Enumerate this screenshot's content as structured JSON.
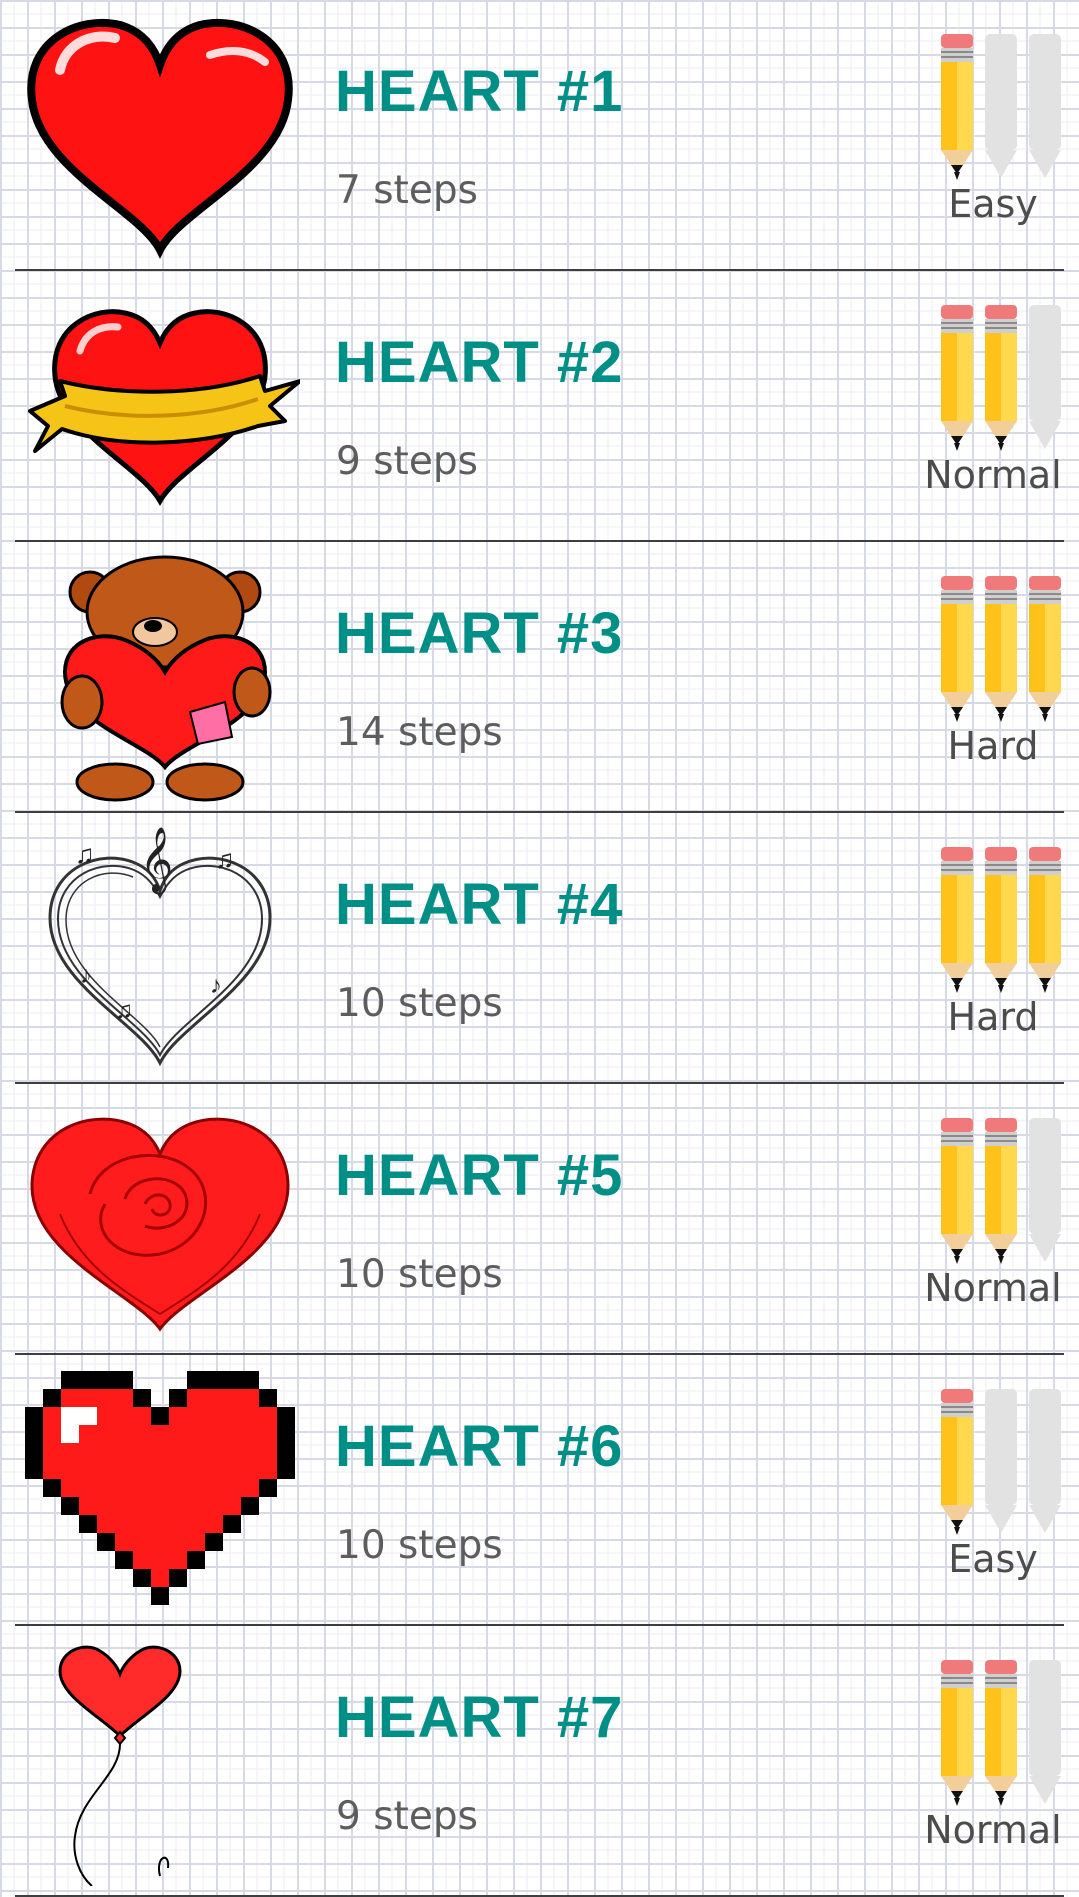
{
  "items": [
    {
      "title": "HEART #1",
      "steps": "7 steps",
      "difficulty": "Easy",
      "level": 1,
      "thumbnail": "glossy-heart-icon"
    },
    {
      "title": "HEART #2",
      "steps": "9 steps",
      "difficulty": "Normal",
      "level": 2,
      "thumbnail": "ribbon-heart-icon"
    },
    {
      "title": "HEART #3",
      "steps": "14 steps",
      "difficulty": "Hard",
      "level": 3,
      "thumbnail": "teddy-bear-heart-icon"
    },
    {
      "title": "HEART #4",
      "steps": "10 steps",
      "difficulty": "Hard",
      "level": 3,
      "thumbnail": "music-notes-heart-icon"
    },
    {
      "title": "HEART #5",
      "steps": "10 steps",
      "difficulty": "Normal",
      "level": 2,
      "thumbnail": "rose-heart-icon"
    },
    {
      "title": "HEART #6",
      "steps": "10 steps",
      "difficulty": "Easy",
      "level": 1,
      "thumbnail": "pixel-heart-icon"
    },
    {
      "title": "HEART #7",
      "steps": "9 steps",
      "difficulty": "Normal",
      "level": 2,
      "thumbnail": "balloon-heart-icon"
    }
  ],
  "colors": {
    "title": "#008f86",
    "steps": "#5d5d5d",
    "difficulty": "#4c4c4c",
    "heart_red": "#ff1a1a",
    "pencil_yellow": "#ffc21a",
    "pencil_eraser": "#f07a7a",
    "pencil_inactive": "#e2e2e2"
  }
}
